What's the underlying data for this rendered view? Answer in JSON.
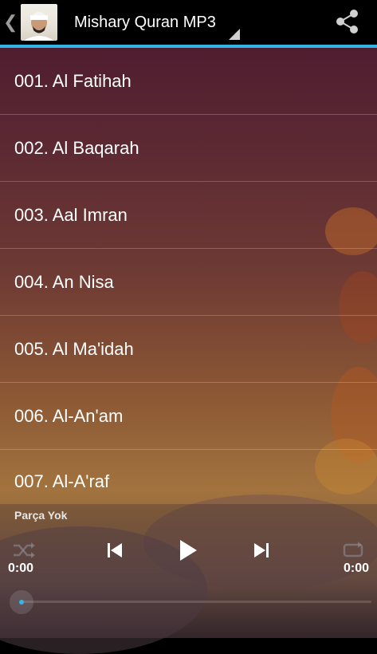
{
  "app": {
    "title": "Mishary Quran MP3"
  },
  "colors": {
    "accent": "#33b5e5",
    "action_bar": "#000000"
  },
  "icons": {
    "back": "chevron-left-icon",
    "share": "share-icon",
    "shuffle": "shuffle-icon",
    "previous": "skip-previous-icon",
    "play": "play-icon",
    "next": "skip-next-icon",
    "repeat": "repeat-icon"
  },
  "surahs": [
    "001. Al Fatihah",
    "002. Al Baqarah",
    "003. Aal Imran",
    "004. An Nisa",
    "005. Al Ma'idah",
    "006. Al-An'am",
    "007. Al-A'raf"
  ],
  "player": {
    "track_label": "Parça Yok",
    "current_time": "0:00",
    "total_time": "0:00",
    "progress": 0
  }
}
